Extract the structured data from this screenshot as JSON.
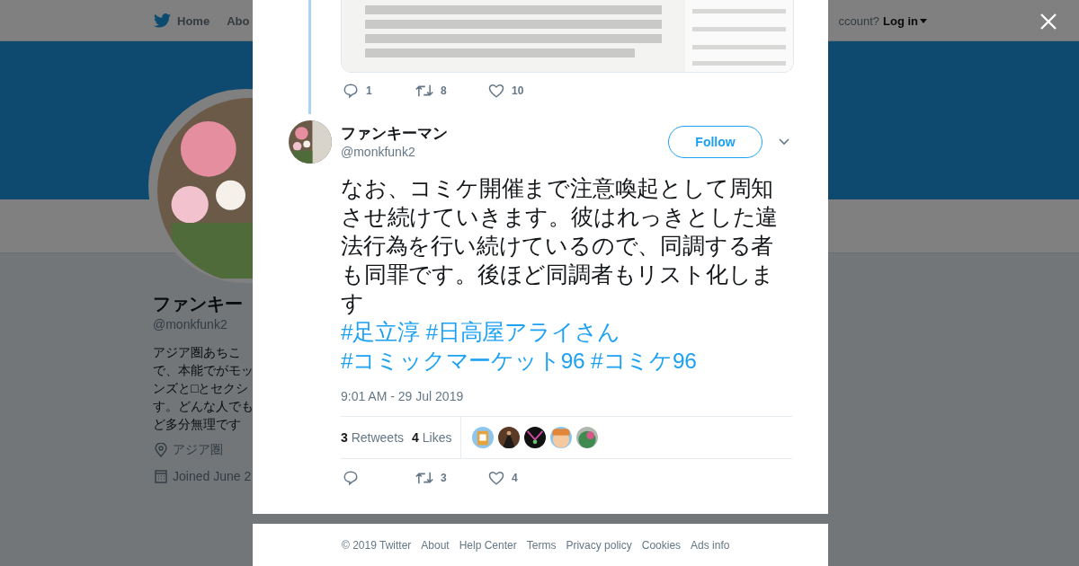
{
  "top_nav": {
    "items": [
      {
        "label": "Home"
      },
      {
        "label": "Abo"
      }
    ],
    "login_prompt": "ccount?",
    "login_link": "Log in"
  },
  "profile": {
    "name": "ファンキー",
    "handle": "@monkfunk2",
    "bio_lines": [
      "アジア圏あちこ",
      "で、本能でがモッ",
      "ンズと□とセクシ",
      "す。どんな人でも",
      "ど多分無理です"
    ],
    "location": "アジア圏",
    "joined": "Joined June 2"
  },
  "modal": {
    "quoted_tweet": {
      "image": {
        "kind": "picture"
      },
      "replies": "1",
      "retweets": "8",
      "likes": "10"
    },
    "tweet": {
      "name": "ファンキーマン",
      "handle": "@monkfunk2",
      "follow_button": "Follow",
      "text": "なお、コミケ開催まで注意喚起として周知させ続けていきます。彼はれっきとした違法行為を行い続けているので、同調する者も同罪です。後ほど同調者もリスト化します",
      "hashtags": [
        "#足立淳",
        "#日高屋アライさん",
        "#コミックマーケット96",
        "#コミケ96"
      ],
      "timestamp": "9:01 AM - 29 Jul 2019",
      "retweet_count": "3",
      "retweet_label": "Retweets",
      "like_count": "4",
      "like_label": "Likes",
      "likers": [
        {
          "kind": "picture"
        },
        {
          "kind": "picture"
        },
        {
          "kind": "picture"
        },
        {
          "kind": "picture"
        },
        {
          "kind": "picture"
        }
      ],
      "retweets": "3",
      "likes": "4"
    }
  },
  "footer": [
    "© 2019 Twitter",
    "About",
    "Help Center",
    "Terms",
    "Privacy policy",
    "Cookies",
    "Ads info"
  ]
}
